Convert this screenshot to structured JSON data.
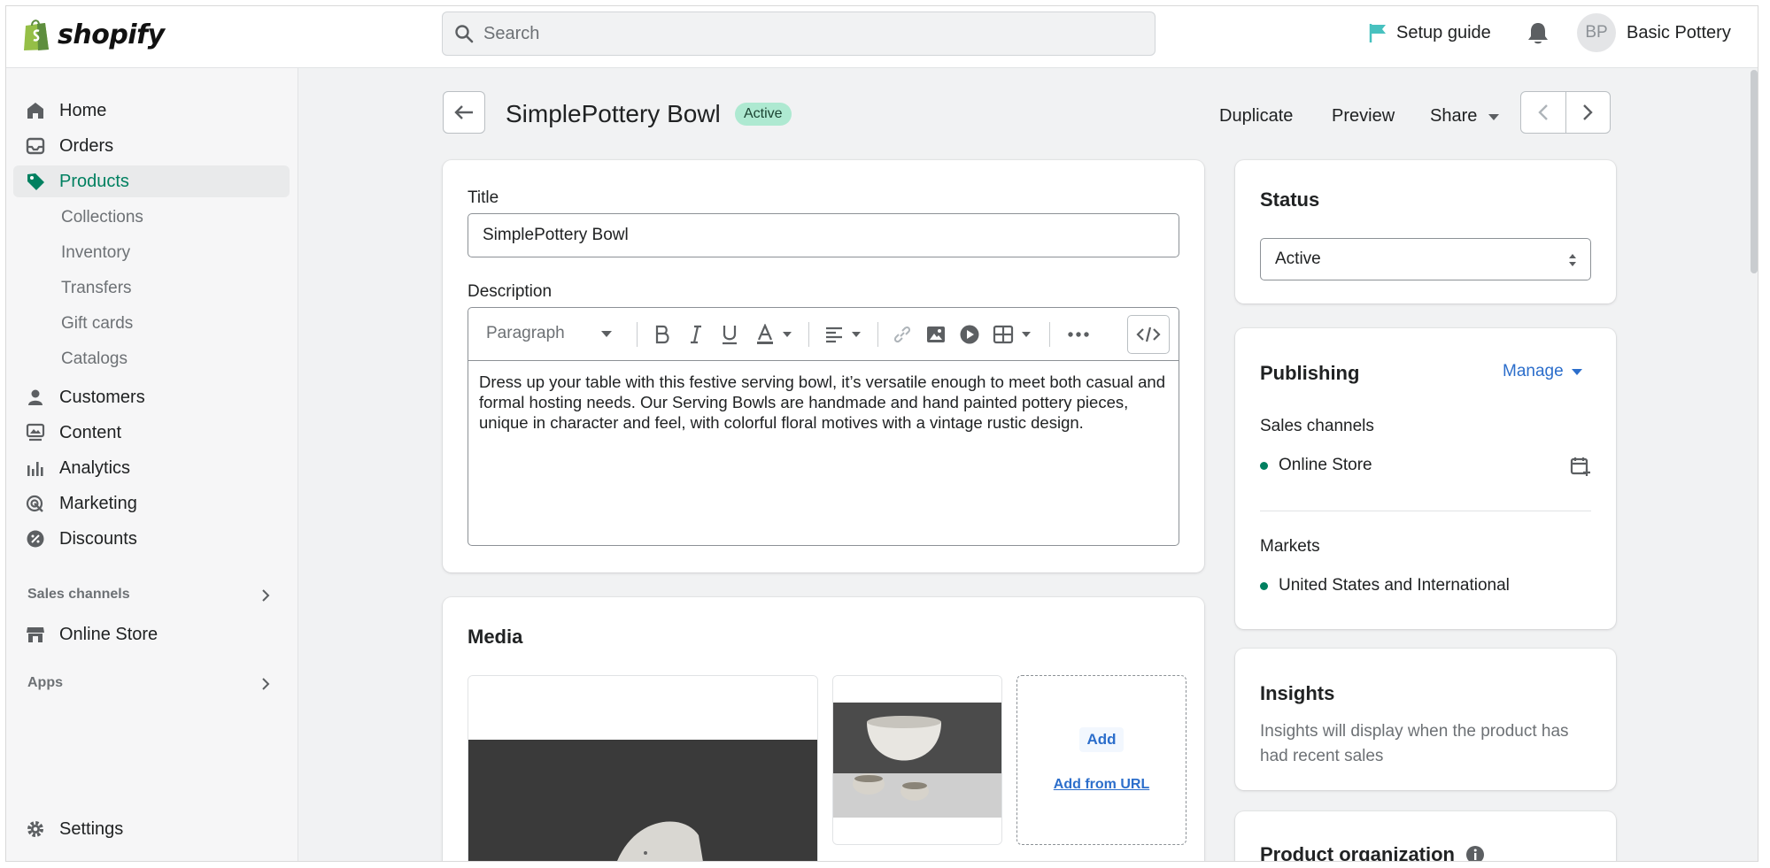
{
  "header": {
    "brand": "shopify",
    "search_placeholder": "Search",
    "setup_guide": "Setup guide",
    "avatar_initials": "BP",
    "store_name": "Basic Pottery"
  },
  "sidebar": {
    "items": [
      {
        "label": "Home",
        "icon": "home-icon"
      },
      {
        "label": "Orders",
        "icon": "orders-icon"
      },
      {
        "label": "Products",
        "icon": "tag-icon",
        "active": true
      },
      {
        "label": "Customers",
        "icon": "person-icon"
      },
      {
        "label": "Content",
        "icon": "content-icon"
      },
      {
        "label": "Analytics",
        "icon": "bar-chart-icon"
      },
      {
        "label": "Marketing",
        "icon": "target-icon"
      },
      {
        "label": "Discounts",
        "icon": "discount-icon"
      }
    ],
    "product_subitems": [
      "Collections",
      "Inventory",
      "Transfers",
      "Gift cards",
      "Catalogs"
    ],
    "sales_channels_label": "Sales channels",
    "online_store": "Online Store",
    "apps_label": "Apps",
    "settings": "Settings"
  },
  "page": {
    "title": "SimplePottery Bowl",
    "status_badge": "Active",
    "actions": {
      "duplicate": "Duplicate",
      "preview": "Preview",
      "share": "Share"
    }
  },
  "product_form": {
    "title_label": "Title",
    "title_value": "SimplePottery Bowl",
    "description_label": "Description",
    "paragraph_format": "Paragraph",
    "description": "Dress up your table with this festive serving bowl, it’s versatile enough to meet both casual and formal hosting needs. Our Serving Bowls are handmade and hand painted pottery pieces, unique in character and feel, with colorful floral motives with a vintage rustic design."
  },
  "media": {
    "title": "Media",
    "add_button": "Add",
    "add_from_url": "Add from URL"
  },
  "status_card": {
    "title": "Status",
    "selected": "Active"
  },
  "publishing": {
    "title": "Publishing",
    "manage": "Manage",
    "sales_channels_label": "Sales channels",
    "channel": "Online Store",
    "markets_label": "Markets",
    "market": "United States and International"
  },
  "insights": {
    "title": "Insights",
    "text": "Insights will display when the product has had recent sales"
  },
  "organization": {
    "title": "Product organization"
  },
  "colors": {
    "accent_green": "#008060",
    "badge_bg": "#aee9d1",
    "link_blue": "#2c6ecb"
  }
}
